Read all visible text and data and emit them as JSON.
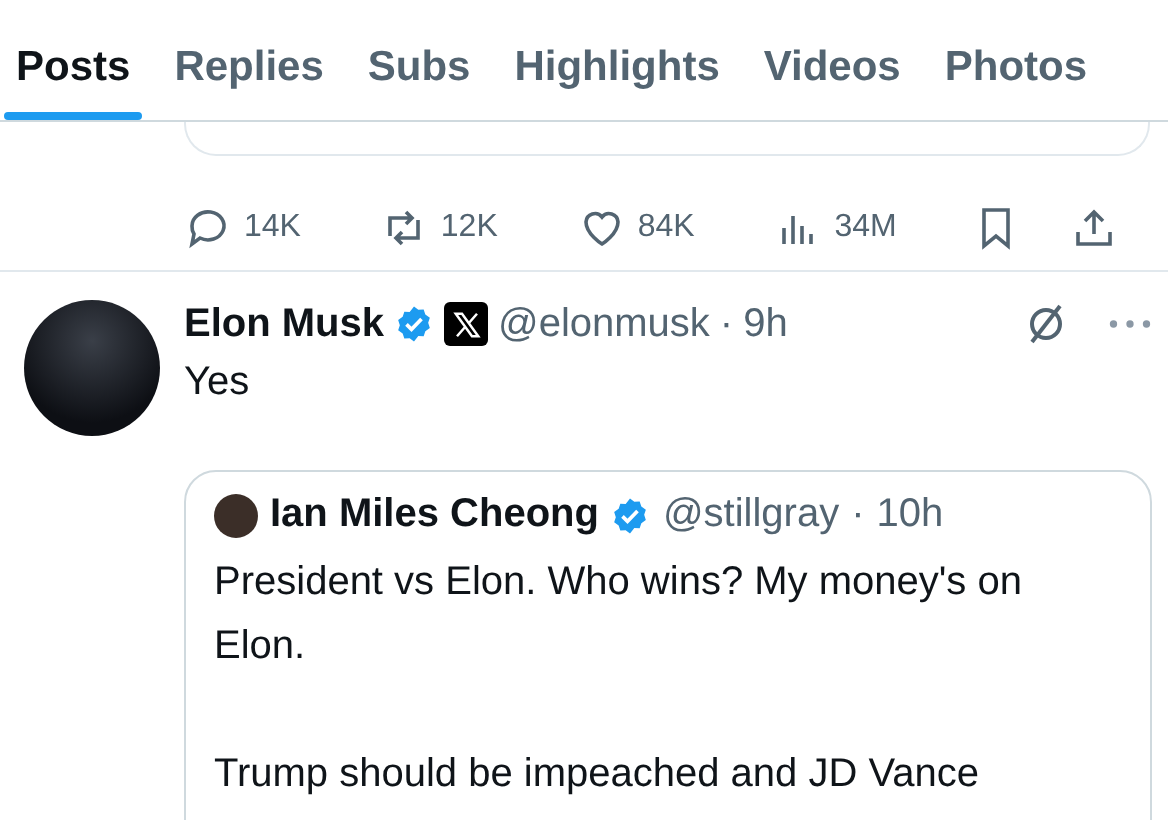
{
  "tabs": [
    {
      "label": "Posts",
      "selected": true
    },
    {
      "label": "Replies",
      "selected": false
    },
    {
      "label": "Subs",
      "selected": false
    },
    {
      "label": "Highlights",
      "selected": false
    },
    {
      "label": "Videos",
      "selected": false
    },
    {
      "label": "Photos",
      "selected": false
    }
  ],
  "previous_post": {
    "actions": [
      {
        "kind": "reply",
        "count": "14K"
      },
      {
        "kind": "repost",
        "count": "12K"
      },
      {
        "kind": "like",
        "count": "84K"
      },
      {
        "kind": "views",
        "count": "34M"
      },
      {
        "kind": "bookmark"
      },
      {
        "kind": "share"
      }
    ]
  },
  "post": {
    "name": "Elon Musk",
    "verified": true,
    "handle": "@elonmusk",
    "separator": "·",
    "time": "9h",
    "text": "Yes",
    "quote": {
      "name": "Ian Miles Cheong",
      "verified": true,
      "handle": "@stillgray",
      "separator": "·",
      "time": "10h",
      "paragraphs": [
        "President vs Elon. Who wins? My money's on Elon.",
        "Trump should be impeached and JD Vance"
      ]
    }
  }
}
